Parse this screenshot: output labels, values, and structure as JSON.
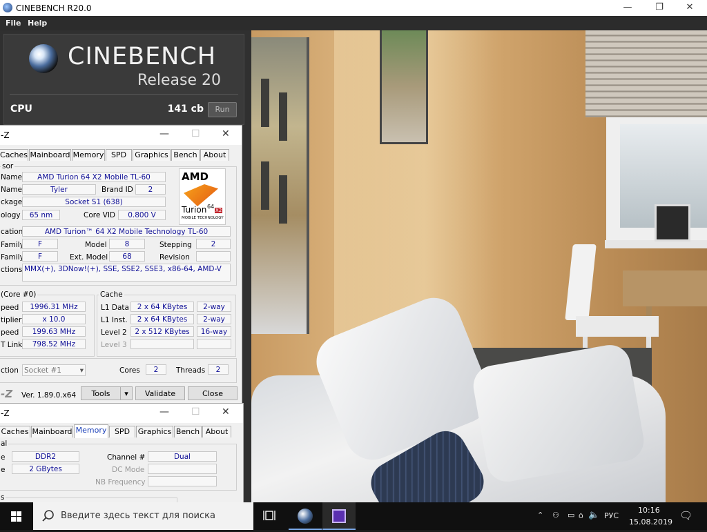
{
  "window": {
    "title": "CINEBENCH R20.0",
    "minimize": "—",
    "maximize": "❐",
    "close": "✕"
  },
  "menu": {
    "file": "File",
    "help": "Help"
  },
  "cinebench": {
    "logo": "CINEBENCH",
    "release": "Release 20",
    "cpu_label": "CPU",
    "score": "141 cb",
    "run": "Run"
  },
  "cpuz1": {
    "title": "-Z",
    "tabs": [
      "Caches",
      "Mainboard",
      "Memory",
      "SPD",
      "Graphics",
      "Bench",
      "About"
    ],
    "processor_group": "sor",
    "labels": {
      "name": "Name",
      "codename": "Name",
      "brandid": "Brand ID",
      "package": "ckage",
      "tech": "ology",
      "corevid": "Core VID",
      "spec": "cation",
      "family": "Family",
      "model": "Model",
      "stepping": "Stepping",
      "extfamily": "Family",
      "extmodel": "Ext. Model",
      "revision": "Revision",
      "instr": "ctions"
    },
    "values": {
      "name": "AMD Turion 64 X2 Mobile TL-60",
      "codename": "Tyler",
      "brandid": "2",
      "package": "Socket S1 (638)",
      "tech": "65 nm",
      "corevid": "0.800 V",
      "spec": "AMD Turion™ 64 X2 Mobile Technology TL-60",
      "family": "F",
      "model": "8",
      "stepping": "2",
      "extfamily": "F",
      "extmodel": "68",
      "revision": "",
      "instr": "MMX(+), 3DNow!(+), SSE, SSE2, SSE3, x86-64, AMD-V"
    },
    "clocks": {
      "group": "(Core #0)",
      "labels": [
        "peed",
        "tiplier",
        "peed",
        "T Link"
      ],
      "values": [
        "1996.31 MHz",
        "x 10.0",
        "199.63 MHz",
        "798.52 MHz"
      ]
    },
    "cache": {
      "group": "Cache",
      "rows": [
        {
          "label": "L1 Data",
          "size": "2 x 64 KBytes",
          "way": "2-way"
        },
        {
          "label": "L1 Inst.",
          "size": "2 x 64 KBytes",
          "way": "2-way"
        },
        {
          "label": "Level 2",
          "size": "2 x 512 KBytes",
          "way": "16-way"
        },
        {
          "label": "Level 3",
          "size": "",
          "way": ""
        }
      ]
    },
    "selection": {
      "label": "ction",
      "value": "Socket #1",
      "cores_label": "Cores",
      "cores": "2",
      "threads_label": "Threads",
      "threads": "2"
    },
    "footer": {
      "logo": "-Z",
      "version": "Ver. 1.89.0.x64",
      "tools": "Tools",
      "validate": "Validate",
      "close": "Close"
    },
    "amd_logo": {
      "brand": "AMD",
      "line1": "Turion",
      "sup": "64",
      "x2": "X2",
      "line2": "MOBILE TECHNOLOGY"
    }
  },
  "cpuz2": {
    "title": "-Z",
    "tabs": [
      "Caches",
      "Mainboard",
      "Memory",
      "SPD",
      "Graphics",
      "Bench",
      "About"
    ],
    "active_tab": "Memory",
    "group": "al",
    "labels": {
      "type": "e",
      "size": "e",
      "channel": "Channel #",
      "dcmode": "DC Mode",
      "nbfreq": "NB Frequency",
      "bottom": "s"
    },
    "values": {
      "type": "DDR2",
      "size": "2 GBytes",
      "channel": "Dual",
      "dcmode": "",
      "nbfreq": ""
    }
  },
  "taskbar": {
    "search_placeholder": "Введите здесь текст для поиска",
    "lang": "РУС",
    "time": "10:16",
    "date": "15.08.2019"
  },
  "colors": {
    "cinebench_bg": "#303030",
    "cpuz_value": "#101097",
    "active_tab": "#1a3fb8",
    "taskbar": "#101010"
  }
}
